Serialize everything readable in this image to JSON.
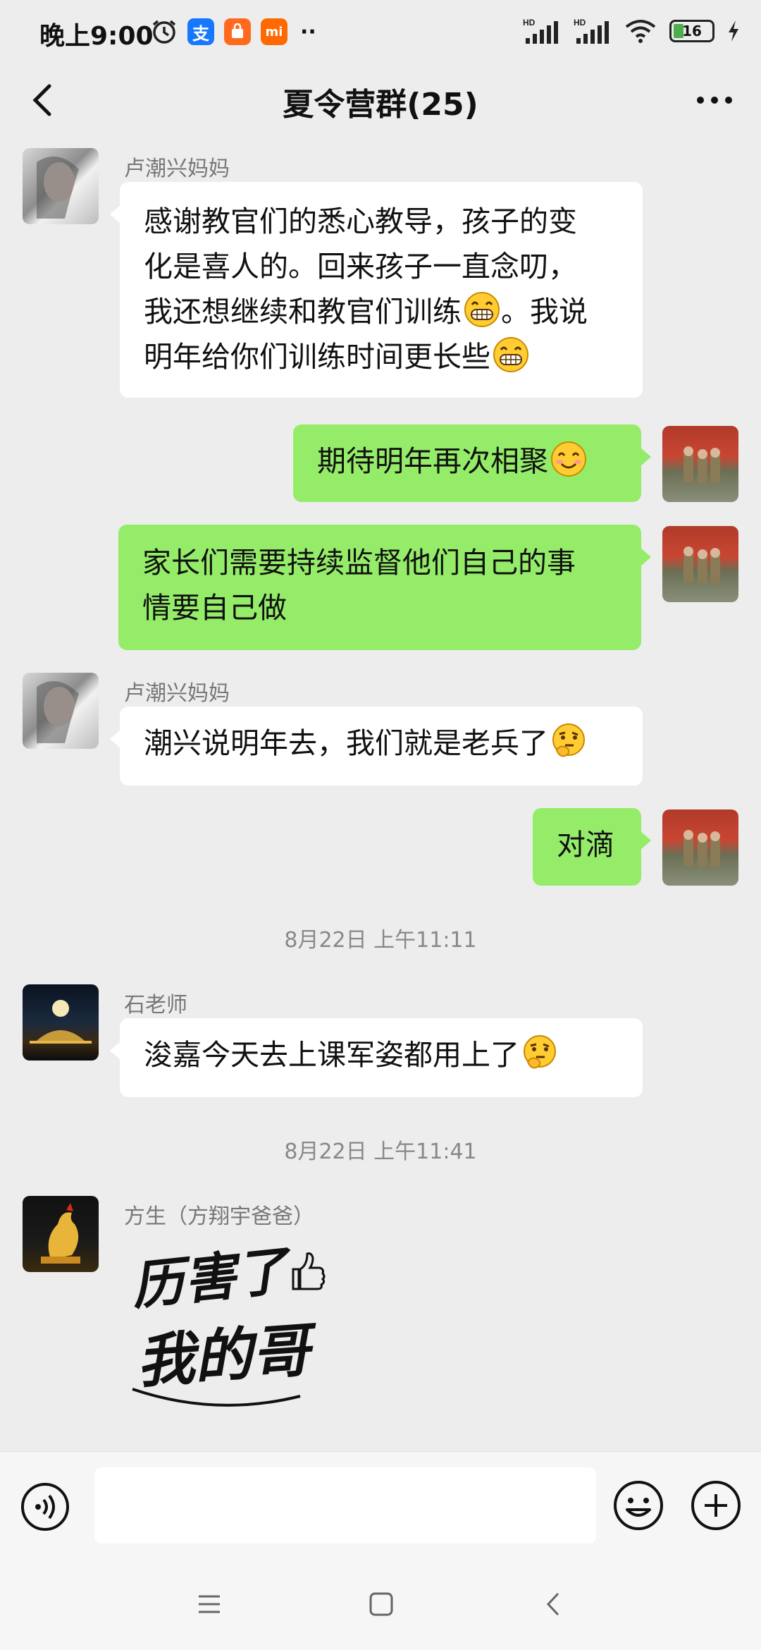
{
  "status_bar": {
    "time": "晚上9:00",
    "battery_level": "16",
    "network_label": "HD",
    "app_icons": [
      "alarm-icon",
      "alipay-icon",
      "taobao-icon",
      "xiaomi-icon"
    ]
  },
  "header": {
    "title": "夏令营群(25)"
  },
  "messages": [
    {
      "sender": "卢潮兴妈妈",
      "text_lines": [
        "感谢教官们的悉心教导，孩子的变",
        "化是喜人的。回来孩子一直念叨，",
        "我还想继续和教官们训练",
        "。我说",
        "明年给你们训练时间更长些"
      ]
    },
    {
      "text": "期待明年再次相聚"
    },
    {
      "text_lines": [
        "家长们需要持续监督他们自己的事",
        "情要自己做"
      ]
    },
    {
      "sender": "卢潮兴妈妈",
      "text": "潮兴说明年去，我们就是老兵了"
    },
    {
      "text": "对滴"
    },
    {
      "timestamp": "8月22日 上午11:11"
    },
    {
      "sender": "石老师",
      "text": "浚嘉今天去上课军姿都用上了"
    },
    {
      "timestamp": "8月22日 上午11:41"
    },
    {
      "sender": "方生（方翔宇爸爸）",
      "sticker_text": [
        "历害了",
        "我的哥"
      ]
    }
  ],
  "emojis": {
    "grin": "grin-emoji",
    "smile": "smile-emoji",
    "thinking": "thinking-emoji"
  },
  "colors": {
    "background": "#ededed",
    "outgoing_bubble": "#95ec69",
    "incoming_bubble": "#ffffff",
    "battery": "#4cae4c"
  }
}
